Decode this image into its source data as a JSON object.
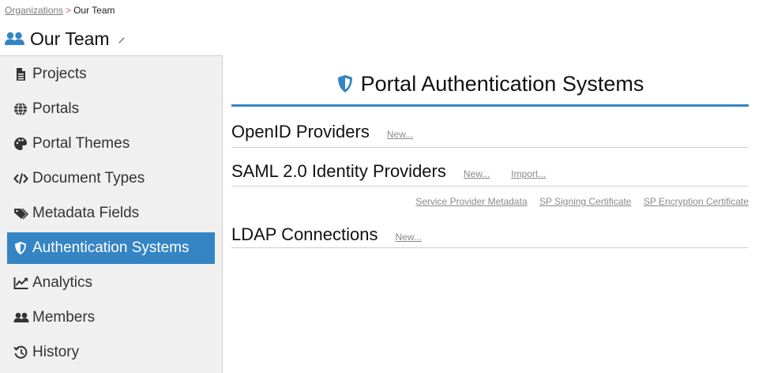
{
  "breadcrumb": {
    "parent": "Organizations",
    "separator": ">",
    "current": "Our Team"
  },
  "team": {
    "title": "Our Team",
    "icon": "users-icon",
    "edit_icon": "pencil-icon"
  },
  "sidebar": {
    "items": [
      {
        "label": "Projects",
        "icon": "file-icon"
      },
      {
        "label": "Portals",
        "icon": "globe-icon"
      },
      {
        "label": "Portal Themes",
        "icon": "palette-icon"
      },
      {
        "label": "Document Types",
        "icon": "code-icon"
      },
      {
        "label": "Metadata Fields",
        "icon": "tags-icon"
      },
      {
        "label": "Authentication Systems",
        "icon": "shield-icon",
        "active": true
      },
      {
        "label": "Analytics",
        "icon": "chart-line-icon"
      },
      {
        "label": "Members",
        "icon": "users-icon"
      },
      {
        "label": "History",
        "icon": "history-icon"
      }
    ]
  },
  "main": {
    "title": "Portal Authentication Systems",
    "openid": {
      "title": "OpenID Providers",
      "new_label": "New..."
    },
    "saml": {
      "title": "SAML 2.0 Identity Providers",
      "new_label": "New...",
      "import_label": "Import...",
      "links": [
        "Service Provider Metadata",
        "SP Signing Certificate",
        "SP Encryption Certificate"
      ]
    },
    "ldap": {
      "title": "LDAP Connections",
      "new_label": "New..."
    }
  },
  "colors": {
    "accent": "#3584c4",
    "sidebar_bg": "#f0f0f0",
    "separator": "#e55a4e",
    "link": "#8a8a8a"
  }
}
